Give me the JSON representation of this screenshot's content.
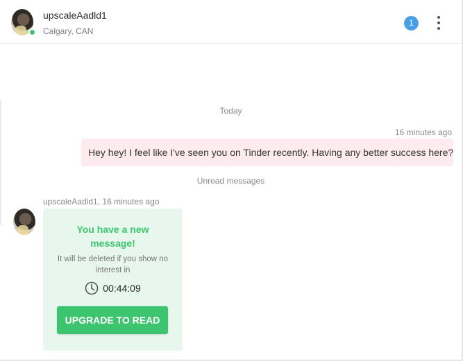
{
  "header": {
    "user_name": "upscaleAadld1",
    "location": "Calgary, CAN",
    "unread_count": "1"
  },
  "conversation": {
    "date_separator": "Today",
    "outgoing": {
      "time": "16 minutes ago",
      "text": "Hey hey! I feel like I've seen you on Tinder recently. Having any better success here?"
    },
    "unread_separator": "Unread messages",
    "incoming": {
      "meta": "upscaleAadld1, 16 minutes ago",
      "locked_card": {
        "title": "You have a new message!",
        "note": "It will be deleted if you show no interest in",
        "countdown": "00:44:09",
        "button_label": "UPGRADE TO READ"
      }
    }
  },
  "colors": {
    "accent_green": "#3cc46f",
    "badge_blue": "#4a9ee8",
    "outgoing_bubble": "#fdebef",
    "locked_card_bg": "#e8f7ed"
  },
  "icons": [
    "user-avatar",
    "online-status-dot",
    "kebab-menu-icon",
    "clock-icon"
  ]
}
